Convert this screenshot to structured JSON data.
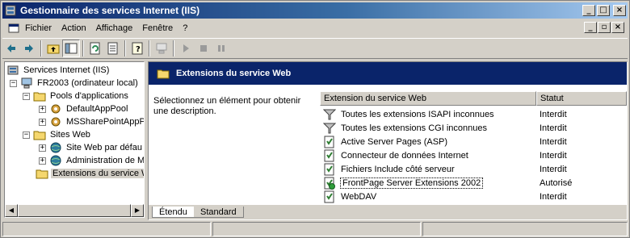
{
  "window": {
    "title": "Gestionnaire des services Internet (IIS)",
    "buttons": {
      "minimize": "_",
      "maximize": "□",
      "close": "×"
    }
  },
  "menubar": {
    "items": [
      {
        "label": "Fichier"
      },
      {
        "label": "Action"
      },
      {
        "label": "Affichage"
      },
      {
        "label": "Fenêtre"
      },
      {
        "label": "?"
      }
    ],
    "mdi_buttons": {
      "minimize": "_",
      "restore": "▫",
      "close": "×"
    }
  },
  "toolbar": {
    "icons": [
      "back-icon",
      "forward-icon",
      "up-folder-icon",
      "show-tree-icon",
      "refresh-icon",
      "export-list-icon",
      "help-icon",
      "computer-icon",
      "play-icon",
      "stop-icon",
      "pause-icon"
    ]
  },
  "tree": {
    "items": [
      {
        "label": "Services Internet (IIS)",
        "icon": "iis-icon"
      },
      {
        "label": "FR2003 (ordinateur local)",
        "icon": "computer-icon",
        "expander": "−"
      },
      {
        "label": "Pools d'applications",
        "icon": "folder-icon",
        "expander": "−"
      },
      {
        "label": "DefaultAppPool",
        "icon": "gear-icon",
        "expander": "+"
      },
      {
        "label": "MSSharePointAppPo",
        "icon": "gear-icon",
        "expander": "+"
      },
      {
        "label": "Sites Web",
        "icon": "folder-icon",
        "expander": "−"
      },
      {
        "label": "Site Web par défau",
        "icon": "globe-icon",
        "expander": "+"
      },
      {
        "label": "Administration de M",
        "icon": "globe-icon",
        "expander": "+"
      },
      {
        "label": "Extensions du service W",
        "icon": "folder-icon",
        "selected": true
      }
    ]
  },
  "details": {
    "header_title": "Extensions du service Web",
    "description": "Sélectionnez un élément pour obtenir une description.",
    "columns": [
      "Extension du service Web",
      "Statut"
    ],
    "rows": [
      {
        "name": "Toutes les extensions ISAPI inconnues",
        "status": "Interdit",
        "icon": "filter-icon"
      },
      {
        "name": "Toutes les extensions CGI inconnues",
        "status": "Interdit",
        "icon": "filter-icon"
      },
      {
        "name": "Active Server Pages (ASP)",
        "status": "Interdit",
        "icon": "extension-icon"
      },
      {
        "name": "Connecteur de données Internet",
        "status": "Interdit",
        "icon": "extension-icon"
      },
      {
        "name": "Fichiers Include côté serveur",
        "status": "Interdit",
        "icon": "extension-icon"
      },
      {
        "name": "FrontPage Server Extensions 2002",
        "status": "Autorisé",
        "icon": "extension-allowed-icon",
        "focused": true
      },
      {
        "name": "WebDAV",
        "status": "Interdit",
        "icon": "extension-icon"
      }
    ],
    "tabs": [
      "Étendu",
      "Standard"
    ]
  }
}
